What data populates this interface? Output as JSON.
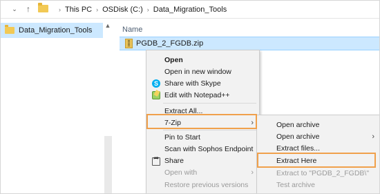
{
  "address_bar": {
    "dropdown_glyph": "⌄",
    "up_glyph": "↑",
    "path": [
      "This PC",
      "OSDisk (C:)",
      "Data_Migration_Tools"
    ],
    "separator": "›"
  },
  "nav_pane": {
    "items": [
      {
        "label": "Data_Migration_Tools",
        "selected": true
      }
    ]
  },
  "content": {
    "column_header": "Name",
    "files": [
      {
        "name": "PGDB_2_FGDB.zip",
        "selected": true
      }
    ]
  },
  "context_menu": {
    "items": [
      {
        "label": "Open",
        "bold": true
      },
      {
        "label": "Open in new window"
      },
      {
        "label": "Share with Skype",
        "icon": "skype-icon"
      },
      {
        "label": "Edit with Notepad++",
        "icon": "notepad-plus-plus-icon"
      },
      {
        "label": "Extract All..."
      },
      {
        "label": "7-Zip",
        "has_submenu": true,
        "highlighted": true
      },
      {
        "label": "Pin to Start"
      },
      {
        "label": "Scan with Sophos Endpoint"
      },
      {
        "label": "Share",
        "icon": "share-icon"
      },
      {
        "label": "Open with",
        "has_submenu": true
      },
      {
        "label": "Restore previous versions",
        "disabled": true
      }
    ],
    "submenu_arrow": "›"
  },
  "submenu_7zip": {
    "items": [
      {
        "label": "Open archive"
      },
      {
        "label": "Open archive",
        "has_submenu": true
      },
      {
        "label": "Extract files..."
      },
      {
        "label": "Extract Here",
        "highlighted": true
      },
      {
        "label": "Extract to \"PGDB_2_FGDB\\\"",
        "disabled": true
      },
      {
        "label": "Test archive",
        "disabled": true
      }
    ]
  },
  "colors": {
    "selection": "#cce8ff",
    "menu_bg": "#f2f2f2",
    "highlight_outline": "#f0a04b",
    "folder": "#f2c955"
  }
}
